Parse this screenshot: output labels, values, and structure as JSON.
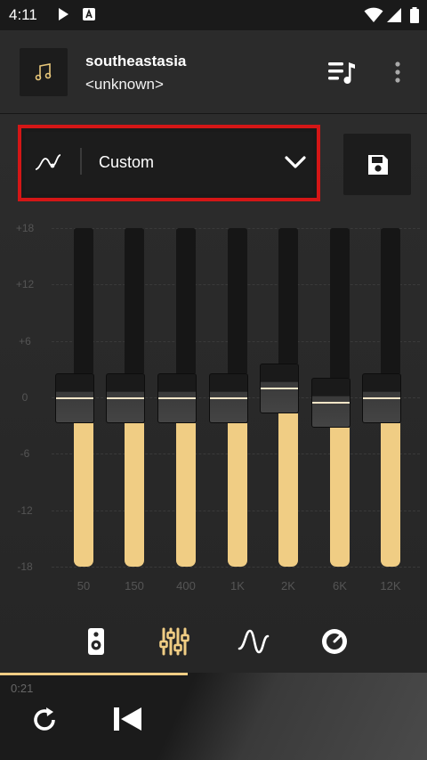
{
  "status_bar": {
    "time": "4:11",
    "icons": [
      "play-icon",
      "notification-a-icon",
      "wifi-icon",
      "signal-icon",
      "battery-icon"
    ]
  },
  "header": {
    "title": "southeastasia",
    "artist": "<unknown>",
    "icons": [
      "music-note-icon",
      "queue-music-icon",
      "more-vert-icon"
    ]
  },
  "preset": {
    "label": "Custom",
    "icons": [
      "curve-icon",
      "chevron-down-icon",
      "save-icon"
    ]
  },
  "equalizer": {
    "db_labels": [
      "+18",
      "+12",
      "+6",
      "0",
      "-6",
      "-12",
      "-18"
    ],
    "bands": [
      {
        "freq": "50",
        "gain_db": 0
      },
      {
        "freq": "150",
        "gain_db": 0
      },
      {
        "freq": "400",
        "gain_db": 0
      },
      {
        "freq": "1K",
        "gain_db": 0
      },
      {
        "freq": "2K",
        "gain_db": 1
      },
      {
        "freq": "6K",
        "gain_db": -0.5
      },
      {
        "freq": "12K",
        "gain_db": 0
      }
    ]
  },
  "tabs": [
    "speaker-icon",
    "equalizer-sliders-icon",
    "waveform-icon",
    "dial-icon"
  ],
  "colors": {
    "accent": "#f0cd84",
    "highlight_border": "#d41616"
  },
  "player": {
    "elapsed": "0:21",
    "progress_fraction": 0.44,
    "icons": [
      "repeat-icon",
      "skip-previous-icon"
    ]
  }
}
